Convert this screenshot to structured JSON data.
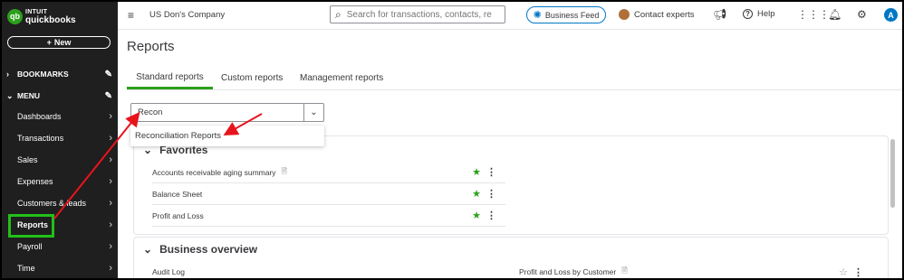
{
  "sidebar": {
    "logo_top": "INTUIT",
    "logo_bottom": "quickbooks",
    "new_label": "New",
    "bookmarks_label": "BOOKMARKS",
    "menu_label": "MENU",
    "items": [
      {
        "label": "Dashboards"
      },
      {
        "label": "Transactions"
      },
      {
        "label": "Sales"
      },
      {
        "label": "Expenses"
      },
      {
        "label": "Customers & leads"
      },
      {
        "label": "Reports"
      },
      {
        "label": "Payroll"
      },
      {
        "label": "Time"
      }
    ]
  },
  "topbar": {
    "company": "US Don's Company",
    "search_placeholder": "Search for transactions, contacts, reports, and more",
    "business_feed": "Business Feed",
    "contact_experts": "Contact experts",
    "help": "Help",
    "user_initial": "A"
  },
  "main": {
    "title": "Reports",
    "tabs": [
      {
        "label": "Standard reports"
      },
      {
        "label": "Custom reports"
      },
      {
        "label": "Management reports"
      }
    ],
    "search_value": "Recon",
    "suggestion": "Reconciliation Reports",
    "favorites": {
      "title": "Favorites",
      "rows": [
        {
          "label": "Accounts receivable aging summary"
        },
        {
          "label": "Balance Sheet"
        },
        {
          "label": "Profit and Loss"
        }
      ]
    },
    "business_overview": {
      "title": "Business overview",
      "rows": [
        {
          "label": "Audit Log"
        },
        {
          "label": "Profit and Loss by Customer"
        }
      ]
    }
  },
  "colors": {
    "sidebar_bg": "#1f1f1f",
    "accent_green": "#2ca01c",
    "highlight_green": "#22c01a",
    "annotation_red": "#e8141c",
    "link_blue": "#0077c5"
  }
}
